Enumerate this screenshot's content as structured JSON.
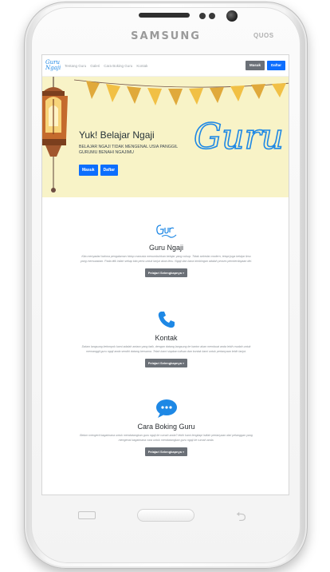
{
  "device": {
    "brand": "SAMSUNG",
    "badge": "QUOS"
  },
  "navbar": {
    "logo": "Guru Ngaji",
    "links": [
      "Tentang Guru",
      "Galeri",
      "Cara Boking Guru",
      "Kontak"
    ],
    "login_label": "Masuk",
    "register_label": "Daftar"
  },
  "hero": {
    "title": "Yuk! Belajar Ngaji",
    "subtitle": "Belajar ngaji tidak mengenal usia panggil gurumu benahi ngajimu",
    "login_label": "Masuk",
    "register_label": "Daftar",
    "art_text": "Guru Ngaji"
  },
  "sections": [
    {
      "title": "Guru Ngaji",
      "text": "Kita menyadari bahwa pengalaman hidup manusia menumbuhkan belajar yang cukup. Tidak sekedar modern, tetapi juga belajar ilmu yang memuaskan. Pada titik inilah setiap kita perlu untuk lanjut akan ilmu. Ngaji dan baca bimbingan adalah proses pemberdayaan diri.",
      "button": "Pelajari Selengkapnya »",
      "icon": "guru-ngaji-logo-icon"
    },
    {
      "title": "Kontak",
      "text": "Dalam langsung kelompok kami adalah antara yang baik, dengan datang langsung ke kantor akan membuat anda lebih mudah untuk memanggil guru ngaji anda sendiri datang bersama. Telah kami siapkan tulisan dan kontak kami untuk pertanyaan lebih lanjut.",
      "button": "Pelajari Selengkapnya »",
      "icon": "phone-icon"
    },
    {
      "title": "Cara Boking Guru",
      "text": "Belum mengerti bagaimana untuk mendatangkan guru ngaji ke rumah anda? lebih kami lengkapi istilah pertanyaan dari pelanggan yang mengenai bagaimana cara untuk mendatangkan guru ngaji ke rumah anda.",
      "button": "Pelajari Selengkapnya »",
      "icon": "chat-bubble-icon"
    }
  ],
  "colors": {
    "accent": "#0d6efd",
    "button_gray": "#6b7077",
    "hero_bg": "#f8f3c7",
    "icon_blue": "#1e88e5"
  }
}
